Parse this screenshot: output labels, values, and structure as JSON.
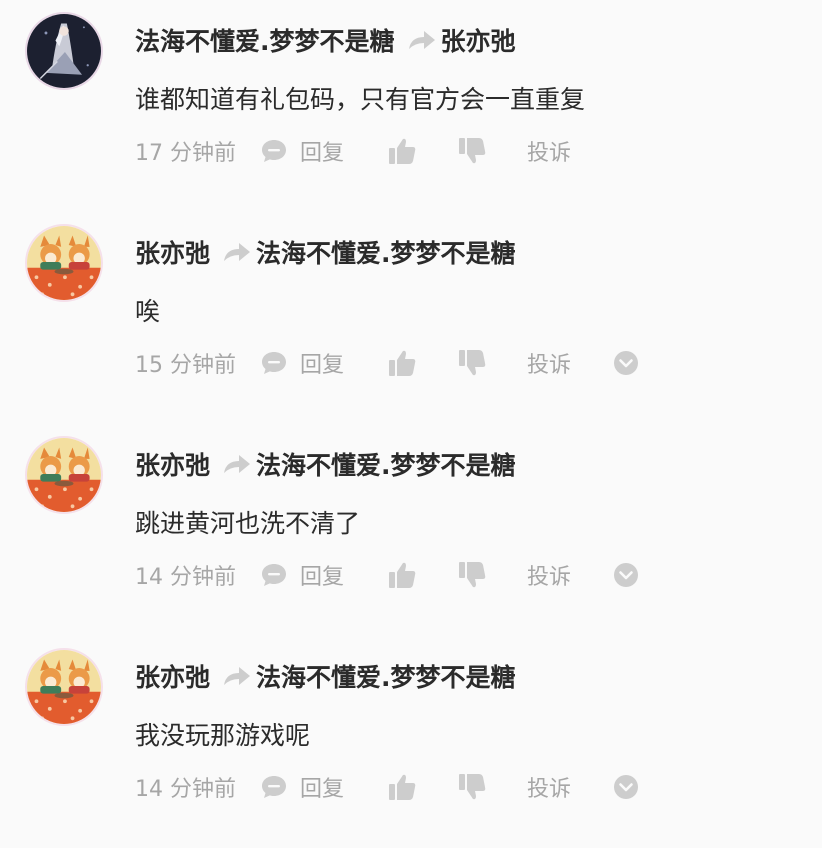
{
  "comments": [
    {
      "author": "法海不懂爱.梦梦不是糖",
      "reply_to": "张亦弛",
      "text": "谁都知道有礼包码，只有官方会一直重复",
      "time": "17 分钟前",
      "reply_label": "回复",
      "report_label": "投诉",
      "avatar_icon": "anime-avatar-dark",
      "has_more": false
    },
    {
      "author": "张亦弛",
      "reply_to": "法海不懂爱.梦梦不是糖",
      "text": "唉",
      "time": "15 分钟前",
      "reply_label": "回复",
      "report_label": "投诉",
      "avatar_icon": "fox-avatar",
      "has_more": true
    },
    {
      "author": "张亦弛",
      "reply_to": "法海不懂爱.梦梦不是糖",
      "text": "跳进黄河也洗不清了",
      "time": "14 分钟前",
      "reply_label": "回复",
      "report_label": "投诉",
      "avatar_icon": "fox-avatar",
      "has_more": true
    },
    {
      "author": "张亦弛",
      "reply_to": "法海不懂爱.梦梦不是糖",
      "text": "我没玩那游戏呢",
      "time": "14 分钟前",
      "reply_label": "回复",
      "report_label": "投诉",
      "avatar_icon": "fox-avatar",
      "has_more": true
    }
  ],
  "colors": {
    "background": "#fafafa",
    "text_primary": "#2b2b2b",
    "text_secondary": "#a6a6a6",
    "icon_gray": "#cdcdcd"
  }
}
